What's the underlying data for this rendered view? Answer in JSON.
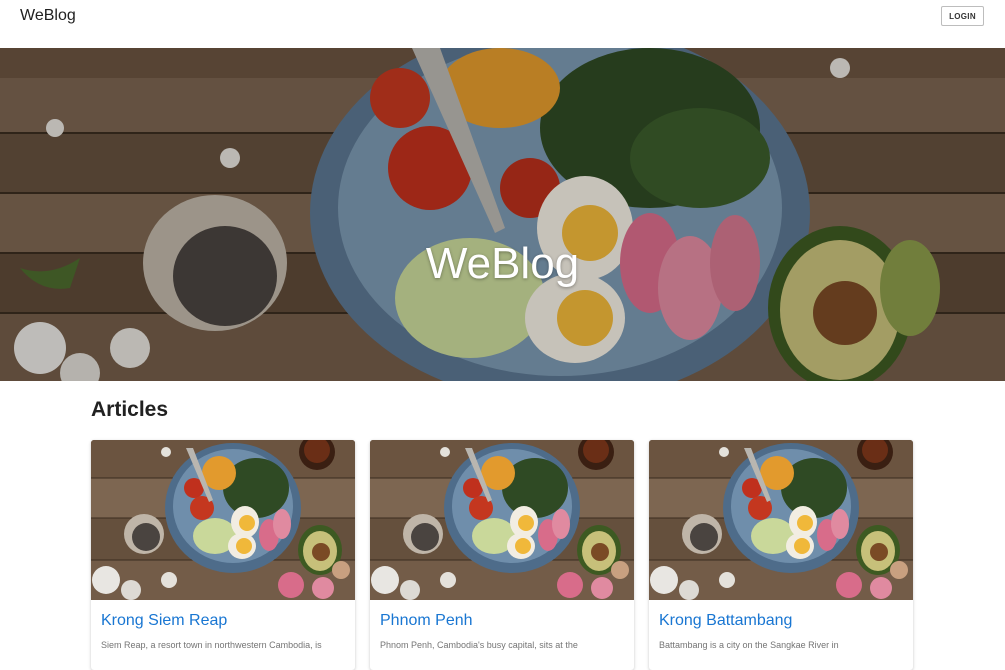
{
  "appbar": {
    "brand": "WeBlog",
    "login_label": "LOGIN"
  },
  "hero": {
    "title": "WeBlog"
  },
  "articles": {
    "heading": "Articles",
    "items": [
      {
        "title": "Krong Siem Reap",
        "excerpt": "Siem Reap, a resort town in northwestern Cambodia, is"
      },
      {
        "title": "Phnom Penh",
        "excerpt": "Phnom Penh, Cambodia's busy capital, sits at the"
      },
      {
        "title": "Krong Battambang",
        "excerpt": "Battambang is a city on the Sangkae River in"
      }
    ]
  },
  "colors": {
    "link": "#1976d2",
    "text": "#212121",
    "muted": "#757575"
  }
}
